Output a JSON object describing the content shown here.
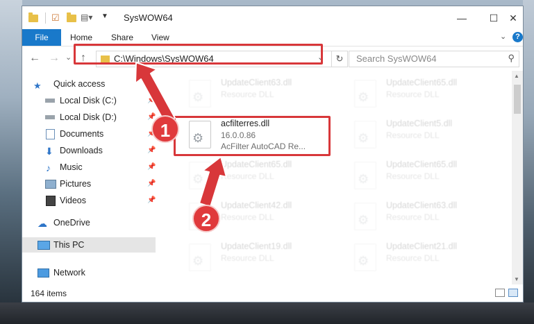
{
  "window": {
    "title": "SysWOW64",
    "controls": {
      "minimize": "—",
      "maximize": "☐",
      "close": "✕"
    }
  },
  "ribbon": {
    "tabs": [
      "File",
      "Home",
      "Share",
      "View"
    ],
    "expand_icon": "chevron-down",
    "help": "?"
  },
  "nav": {
    "back": "←",
    "forward": "→",
    "recent": "⌄",
    "up": "↑",
    "address": "C:\\Windows\\SysWOW64",
    "address_chevron": "⌄",
    "refresh": "↻",
    "search_placeholder": "Search SysWOW64",
    "search_icon": "⚲"
  },
  "sidebar": {
    "items": [
      {
        "label": "Quick access",
        "icon": "star-icon",
        "pinned": false
      },
      {
        "label": "Local Disk (C:)",
        "icon": "drive-icon",
        "pinned": true
      },
      {
        "label": "Local Disk (D:)",
        "icon": "drive-icon",
        "pinned": true
      },
      {
        "label": "Documents",
        "icon": "documents-icon",
        "pinned": true
      },
      {
        "label": "Downloads",
        "icon": "download-icon",
        "pinned": true
      },
      {
        "label": "Music",
        "icon": "music-icon",
        "pinned": true
      },
      {
        "label": "Pictures",
        "icon": "pictures-icon",
        "pinned": true
      },
      {
        "label": "Videos",
        "icon": "videos-icon",
        "pinned": true
      },
      {
        "label": "OneDrive",
        "icon": "cloud-icon",
        "pinned": false
      },
      {
        "label": "This PC",
        "icon": "computer-icon",
        "pinned": false,
        "selected": true
      },
      {
        "label": "Network",
        "icon": "network-icon",
        "pinned": false
      }
    ]
  },
  "files": {
    "highlighted": {
      "name": "acfilterres.dll",
      "version": "16.0.0.86",
      "description": "AcFilter AutoCAD Re..."
    },
    "faded": [
      {
        "name": "UpdateClient63.dll",
        "type": "Resource DLL"
      },
      {
        "name": "UpdateClient65.dll",
        "type": "Resource DLL"
      },
      {
        "name": "UpdateClient5.dll",
        "type": "Resource DLL"
      },
      {
        "name": "UpdateClient65.dll",
        "type": "Resource DLL"
      },
      {
        "name": "UpdateClient65.dll",
        "type": "Resource DLL"
      },
      {
        "name": "UpdateClient42.dll",
        "type": "Resource DLL"
      },
      {
        "name": "UpdateClient63.dll",
        "type": "Resource DLL"
      },
      {
        "name": "UpdateClient19.dll",
        "type": "Resource DLL"
      },
      {
        "name": "UpdateClient21.dll",
        "type": "Resource DLL"
      }
    ]
  },
  "status": {
    "count": "164 items"
  },
  "annotations": {
    "step1": "1",
    "step2": "2",
    "color": "#d8373a"
  }
}
